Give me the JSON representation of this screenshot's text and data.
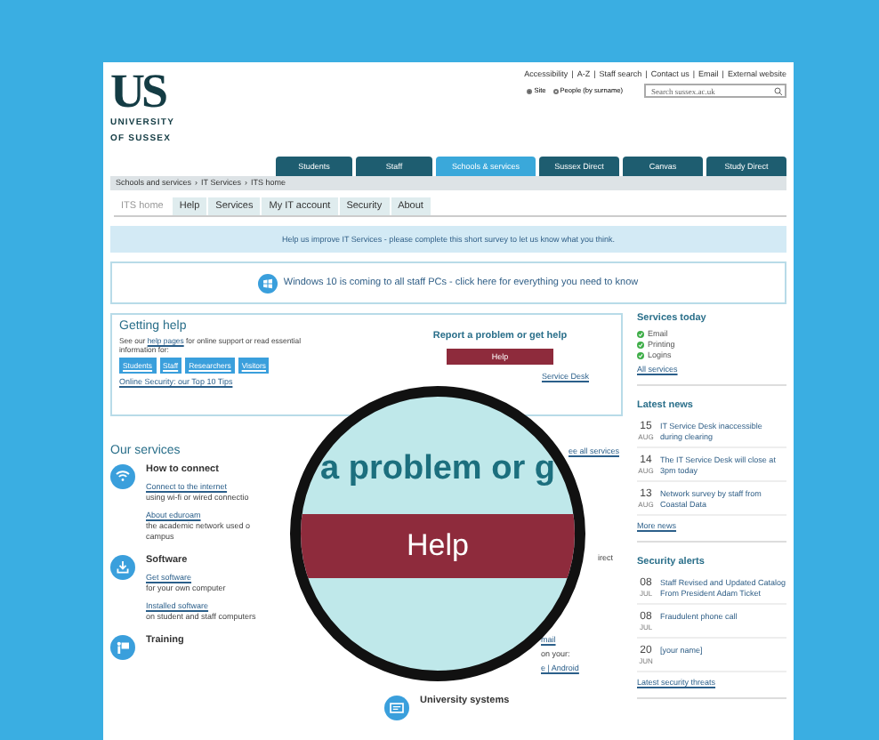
{
  "header": {
    "logo": {
      "mark": "US",
      "lines": [
        "UNIVERSITY",
        "OF SUSSEX"
      ]
    },
    "top_links": [
      "Accessibility",
      "A-Z",
      "Staff search",
      "Contact us",
      "Email",
      "External website"
    ],
    "search_scope": [
      {
        "label": "Site",
        "selected": true
      },
      {
        "label": "People (by surname)",
        "selected": false
      }
    ],
    "search": {
      "placeholder": "Search sussex.ac.uk"
    },
    "link_separator": "|"
  },
  "nav_tabs": [
    {
      "label": "Students",
      "selected": false
    },
    {
      "label": "Staff",
      "selected": false
    },
    {
      "label": "Schools & services",
      "selected": true
    },
    {
      "label": "Sussex Direct",
      "selected": false
    },
    {
      "label": "Canvas",
      "selected": false
    },
    {
      "label": "Study Direct",
      "selected": false
    }
  ],
  "breadcrumb": {
    "separator": "›",
    "items": [
      "Schools and services",
      "IT Services",
      "ITS home"
    ]
  },
  "sub_tabs": [
    {
      "label": "ITS home",
      "selected": true
    },
    {
      "label": "Help",
      "selected": false
    },
    {
      "label": "Services",
      "selected": false
    },
    {
      "label": "My IT account",
      "selected": false
    },
    {
      "label": "Security",
      "selected": false
    },
    {
      "label": "About",
      "selected": false
    }
  ],
  "survey_banner": "Help us improve IT Services - please complete this short survey to let us know what you think.",
  "windows_banner": "Windows 10 is coming to all staff PCs - click here for everything you need to know",
  "getting_help": {
    "title": "Getting help",
    "intro_before": "See our",
    "intro_link": "help pages",
    "intro_after": "for online support or read essential information for:",
    "audiences": [
      "Students",
      "Staff",
      "Researchers",
      "Visitors"
    ],
    "security_link": "Online Security: our Top 10 Tips"
  },
  "report": {
    "title": "Report a problem or get help",
    "button": "Help",
    "desk_link": "Service Desk"
  },
  "our_services": {
    "title": "Our services",
    "see_all": "ee all services",
    "left": [
      {
        "kind": "wifi",
        "title": "How to connect",
        "links": [
          {
            "link": "Connect to the internet",
            "desc": [
              "using wi-fi or wired connectio"
            ]
          },
          {
            "link": "About eduroam",
            "desc": [
              "the academic network used o",
              "campus"
            ]
          }
        ]
      },
      {
        "kind": "download",
        "title": "Software",
        "links": [
          {
            "link": "Get software",
            "desc": [
              "for your own computer"
            ]
          },
          {
            "link": "Installed software",
            "desc": [
              "on student and staff computers"
            ]
          }
        ]
      },
      {
        "kind": "training",
        "title": "Training"
      }
    ],
    "right_fragments": [
      {
        "kind": "text",
        "text": "irect"
      },
      {
        "kind": "link",
        "text": "mail"
      },
      {
        "kind": "text",
        "text": "on your:"
      },
      {
        "kind": "link",
        "text": "e | Android"
      }
    ],
    "right": [
      {
        "kind": "card",
        "title": "University systems"
      }
    ]
  },
  "sidebar": {
    "services_today": {
      "title": "Services today",
      "items": [
        {
          "label": "Email",
          "ok": true
        },
        {
          "label": "Printing",
          "ok": true
        },
        {
          "label": "Logins",
          "ok": true
        }
      ],
      "link": "All services"
    },
    "latest_news": {
      "title": "Latest news",
      "items": [
        {
          "day": "15",
          "month": "AUG",
          "text": "IT Service Desk inaccessible during clearing"
        },
        {
          "day": "14",
          "month": "AUG",
          "text": "The IT Service Desk will close at 3pm today"
        },
        {
          "day": "13",
          "month": "AUG",
          "text": "Network survey by staff from Coastal Data"
        }
      ],
      "link": "More news"
    },
    "security_alerts": {
      "title": "Security alerts",
      "items": [
        {
          "day": "08",
          "month": "JUL",
          "text": "Staff Revised and Updated Catalog From President Adam Ticket"
        },
        {
          "day": "08",
          "month": "JUL",
          "text": "Fraudulent phone call"
        },
        {
          "day": "20",
          "month": "JUN",
          "text": "[your name]"
        }
      ],
      "link": "Latest security threats"
    }
  },
  "magnifier": {
    "heading": "a problem or g",
    "button": "Help"
  }
}
